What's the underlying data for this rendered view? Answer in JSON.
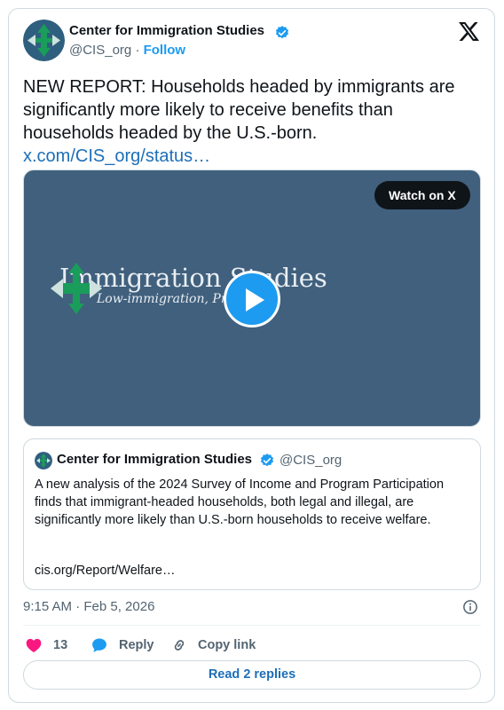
{
  "author": {
    "name": "Center for Immigration Studies",
    "handle": "@CIS_org",
    "separator": "·",
    "follow_label": "Follow"
  },
  "tweet": {
    "text": "NEW REPORT: Households headed by immigrants are significantly more likely to receive benefits than households headed by the U.S.-born.",
    "link_text": "x.com/CIS_org/status…"
  },
  "video": {
    "watch_label": "Watch on X",
    "title_overlay": "Immigration Studies",
    "subtitle_overlay": "Low-immigration, Pro-I"
  },
  "quote": {
    "name": "Center for Immigration Studies",
    "handle": "@CIS_org",
    "text": "A new analysis of the 2024 Survey of Income and Program Participation finds that immigrant-headed households, both legal and illegal, are significantly more likely than U.S.-born households to receive welfare.",
    "link_text": "cis.org/Report/Welfare…"
  },
  "timestamp": "9:15 AM · Feb 5, 2026",
  "actions": {
    "like_count": "13",
    "reply_label": "Reply",
    "copy_label": "Copy link"
  },
  "read_replies_label": "Read 2 replies",
  "colors": {
    "accent": "#1d9bf0",
    "link": "#1d6fb8",
    "like": "#f91880",
    "video_bg": "#40607d"
  },
  "icons": [
    "avatar-logo",
    "verified-badge-icon",
    "x-logo-icon",
    "play-icon",
    "info-icon",
    "heart-icon",
    "reply-bubble-icon",
    "link-icon"
  ]
}
